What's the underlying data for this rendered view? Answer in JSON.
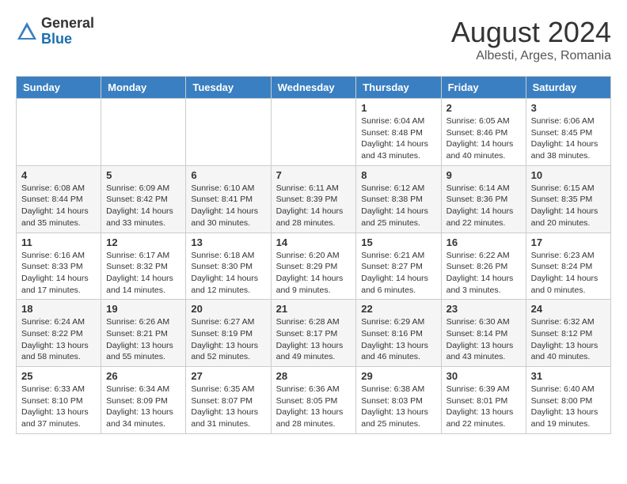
{
  "logo": {
    "general": "General",
    "blue": "Blue"
  },
  "title": "August 2024",
  "location": "Albesti, Arges, Romania",
  "days_of_week": [
    "Sunday",
    "Monday",
    "Tuesday",
    "Wednesday",
    "Thursday",
    "Friday",
    "Saturday"
  ],
  "weeks": [
    [
      {
        "day": "",
        "info": ""
      },
      {
        "day": "",
        "info": ""
      },
      {
        "day": "",
        "info": ""
      },
      {
        "day": "",
        "info": ""
      },
      {
        "day": "1",
        "info": "Sunrise: 6:04 AM\nSunset: 8:48 PM\nDaylight: 14 hours and 43 minutes."
      },
      {
        "day": "2",
        "info": "Sunrise: 6:05 AM\nSunset: 8:46 PM\nDaylight: 14 hours and 40 minutes."
      },
      {
        "day": "3",
        "info": "Sunrise: 6:06 AM\nSunset: 8:45 PM\nDaylight: 14 hours and 38 minutes."
      }
    ],
    [
      {
        "day": "4",
        "info": "Sunrise: 6:08 AM\nSunset: 8:44 PM\nDaylight: 14 hours and 35 minutes."
      },
      {
        "day": "5",
        "info": "Sunrise: 6:09 AM\nSunset: 8:42 PM\nDaylight: 14 hours and 33 minutes."
      },
      {
        "day": "6",
        "info": "Sunrise: 6:10 AM\nSunset: 8:41 PM\nDaylight: 14 hours and 30 minutes."
      },
      {
        "day": "7",
        "info": "Sunrise: 6:11 AM\nSunset: 8:39 PM\nDaylight: 14 hours and 28 minutes."
      },
      {
        "day": "8",
        "info": "Sunrise: 6:12 AM\nSunset: 8:38 PM\nDaylight: 14 hours and 25 minutes."
      },
      {
        "day": "9",
        "info": "Sunrise: 6:14 AM\nSunset: 8:36 PM\nDaylight: 14 hours and 22 minutes."
      },
      {
        "day": "10",
        "info": "Sunrise: 6:15 AM\nSunset: 8:35 PM\nDaylight: 14 hours and 20 minutes."
      }
    ],
    [
      {
        "day": "11",
        "info": "Sunrise: 6:16 AM\nSunset: 8:33 PM\nDaylight: 14 hours and 17 minutes."
      },
      {
        "day": "12",
        "info": "Sunrise: 6:17 AM\nSunset: 8:32 PM\nDaylight: 14 hours and 14 minutes."
      },
      {
        "day": "13",
        "info": "Sunrise: 6:18 AM\nSunset: 8:30 PM\nDaylight: 14 hours and 12 minutes."
      },
      {
        "day": "14",
        "info": "Sunrise: 6:20 AM\nSunset: 8:29 PM\nDaylight: 14 hours and 9 minutes."
      },
      {
        "day": "15",
        "info": "Sunrise: 6:21 AM\nSunset: 8:27 PM\nDaylight: 14 hours and 6 minutes."
      },
      {
        "day": "16",
        "info": "Sunrise: 6:22 AM\nSunset: 8:26 PM\nDaylight: 14 hours and 3 minutes."
      },
      {
        "day": "17",
        "info": "Sunrise: 6:23 AM\nSunset: 8:24 PM\nDaylight: 14 hours and 0 minutes."
      }
    ],
    [
      {
        "day": "18",
        "info": "Sunrise: 6:24 AM\nSunset: 8:22 PM\nDaylight: 13 hours and 58 minutes."
      },
      {
        "day": "19",
        "info": "Sunrise: 6:26 AM\nSunset: 8:21 PM\nDaylight: 13 hours and 55 minutes."
      },
      {
        "day": "20",
        "info": "Sunrise: 6:27 AM\nSunset: 8:19 PM\nDaylight: 13 hours and 52 minutes."
      },
      {
        "day": "21",
        "info": "Sunrise: 6:28 AM\nSunset: 8:17 PM\nDaylight: 13 hours and 49 minutes."
      },
      {
        "day": "22",
        "info": "Sunrise: 6:29 AM\nSunset: 8:16 PM\nDaylight: 13 hours and 46 minutes."
      },
      {
        "day": "23",
        "info": "Sunrise: 6:30 AM\nSunset: 8:14 PM\nDaylight: 13 hours and 43 minutes."
      },
      {
        "day": "24",
        "info": "Sunrise: 6:32 AM\nSunset: 8:12 PM\nDaylight: 13 hours and 40 minutes."
      }
    ],
    [
      {
        "day": "25",
        "info": "Sunrise: 6:33 AM\nSunset: 8:10 PM\nDaylight: 13 hours and 37 minutes."
      },
      {
        "day": "26",
        "info": "Sunrise: 6:34 AM\nSunset: 8:09 PM\nDaylight: 13 hours and 34 minutes."
      },
      {
        "day": "27",
        "info": "Sunrise: 6:35 AM\nSunset: 8:07 PM\nDaylight: 13 hours and 31 minutes."
      },
      {
        "day": "28",
        "info": "Sunrise: 6:36 AM\nSunset: 8:05 PM\nDaylight: 13 hours and 28 minutes."
      },
      {
        "day": "29",
        "info": "Sunrise: 6:38 AM\nSunset: 8:03 PM\nDaylight: 13 hours and 25 minutes."
      },
      {
        "day": "30",
        "info": "Sunrise: 6:39 AM\nSunset: 8:01 PM\nDaylight: 13 hours and 22 minutes."
      },
      {
        "day": "31",
        "info": "Sunrise: 6:40 AM\nSunset: 8:00 PM\nDaylight: 13 hours and 19 minutes."
      }
    ]
  ]
}
